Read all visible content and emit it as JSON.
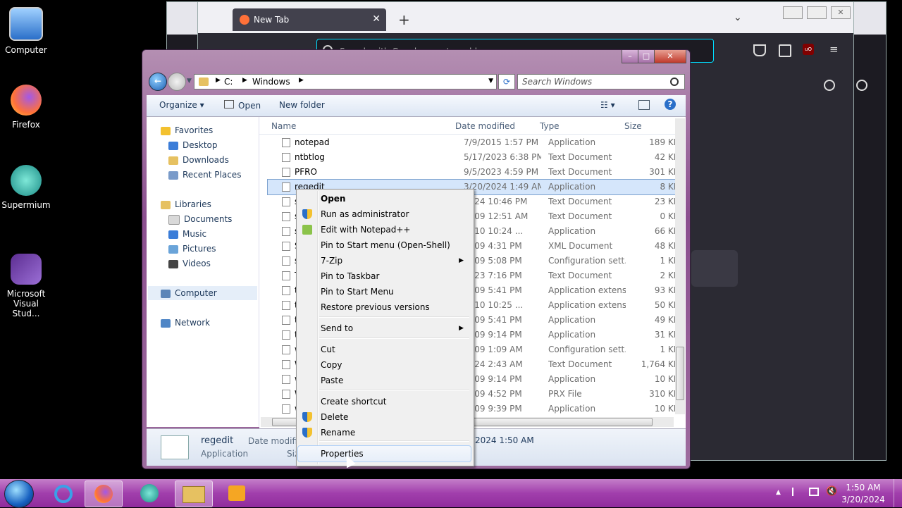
{
  "desktop": {
    "icons": [
      {
        "label": "Computer"
      },
      {
        "label": "Firefox"
      },
      {
        "label": "Supermium"
      },
      {
        "label": "Microsoft Visual Stud..."
      }
    ]
  },
  "browser": {
    "tab_title": "New Tab",
    "address_placeholder": "Search with Google or enter address"
  },
  "explorer": {
    "breadcrumb": [
      "C:",
      "Windows"
    ],
    "search_placeholder": "Search Windows",
    "toolbar": {
      "organize": "Organize",
      "open": "Open",
      "new_folder": "New folder"
    },
    "nav": {
      "favorites": "Favorites",
      "desktop": "Desktop",
      "downloads": "Downloads",
      "recent": "Recent Places",
      "libraries": "Libraries",
      "documents": "Documents",
      "music": "Music",
      "pictures": "Pictures",
      "videos": "Videos",
      "computer": "Computer",
      "network": "Network"
    },
    "columns": {
      "name": "Name",
      "date": "Date modified",
      "type": "Type",
      "size": "Size"
    },
    "files": [
      {
        "name": "notepad",
        "date": "7/9/2015 1:57 PM",
        "type": "Application",
        "size": "189 KB"
      },
      {
        "name": "ntbtlog",
        "date": "5/17/2023 6:38 PM",
        "type": "Text Document",
        "size": "42 KB"
      },
      {
        "name": "PFRO",
        "date": "9/5/2023 4:59 PM",
        "type": "Text Document",
        "size": "301 KB"
      },
      {
        "name": "regedit",
        "date": "3/20/2024 1:49 AM",
        "type": "Application",
        "size": "8 KB"
      },
      {
        "name": "set",
        "date": "2024 10:46 PM",
        "type": "Text Document",
        "size": "23 KB"
      },
      {
        "name": "set",
        "date": "2009 12:51 AM",
        "type": "Text Document",
        "size": "0 KB"
      },
      {
        "name": "sp",
        "date": "2010 10:24 ...",
        "type": "Application",
        "size": "66 KB"
      },
      {
        "name": "Sta",
        "date": "2009 4:31 PM",
        "type": "XML Document",
        "size": "48 KB"
      },
      {
        "name": "sys",
        "date": "2009 5:08 PM",
        "type": "Configuration sett...",
        "size": "1 KB"
      },
      {
        "name": "TS",
        "date": "2023 7:16 PM",
        "type": "Text Document",
        "size": "2 KB"
      },
      {
        "name": "tw",
        "date": "2009 5:41 PM",
        "type": "Application extens...",
        "size": "93 KB"
      },
      {
        "name": "tw",
        "date": "2010 10:25 ...",
        "type": "Application extens...",
        "size": "50 KB"
      },
      {
        "name": "tw",
        "date": "2009 5:41 PM",
        "type": "Application",
        "size": "49 KB"
      },
      {
        "name": "tw",
        "date": "2009 9:14 PM",
        "type": "Application",
        "size": "31 KB"
      },
      {
        "name": "wi",
        "date": "2009 1:09 AM",
        "type": "Configuration sett...",
        "size": "1 KB"
      },
      {
        "name": "Wi",
        "date": "2024 2:43 AM",
        "type": "Text Document",
        "size": "1,764 KB"
      },
      {
        "name": "wi",
        "date": "2009 9:14 PM",
        "type": "Application",
        "size": "10 KB"
      },
      {
        "name": "WI",
        "date": "2009 4:52 PM",
        "type": "PRX File",
        "size": "310 KB"
      },
      {
        "name": "wr",
        "date": "2009 9:39 PM",
        "type": "Application",
        "size": "10 KB"
      }
    ],
    "details": {
      "name": "regedit",
      "type": "Application",
      "date_label": "Date modifie",
      "date_value": "2024 1:50 AM",
      "size_label": "Siz"
    }
  },
  "context_menu": {
    "items": [
      "Open",
      "Run as administrator",
      "Edit with Notepad++",
      "Pin to Start menu (Open-Shell)",
      "7-Zip",
      "Pin to Taskbar",
      "Pin to Start Menu",
      "Restore previous versions",
      "Send to",
      "Cut",
      "Copy",
      "Paste",
      "Create shortcut",
      "Delete",
      "Rename",
      "Properties"
    ]
  },
  "taskbar": {
    "time": "1:50 AM",
    "date": "3/20/2024"
  }
}
